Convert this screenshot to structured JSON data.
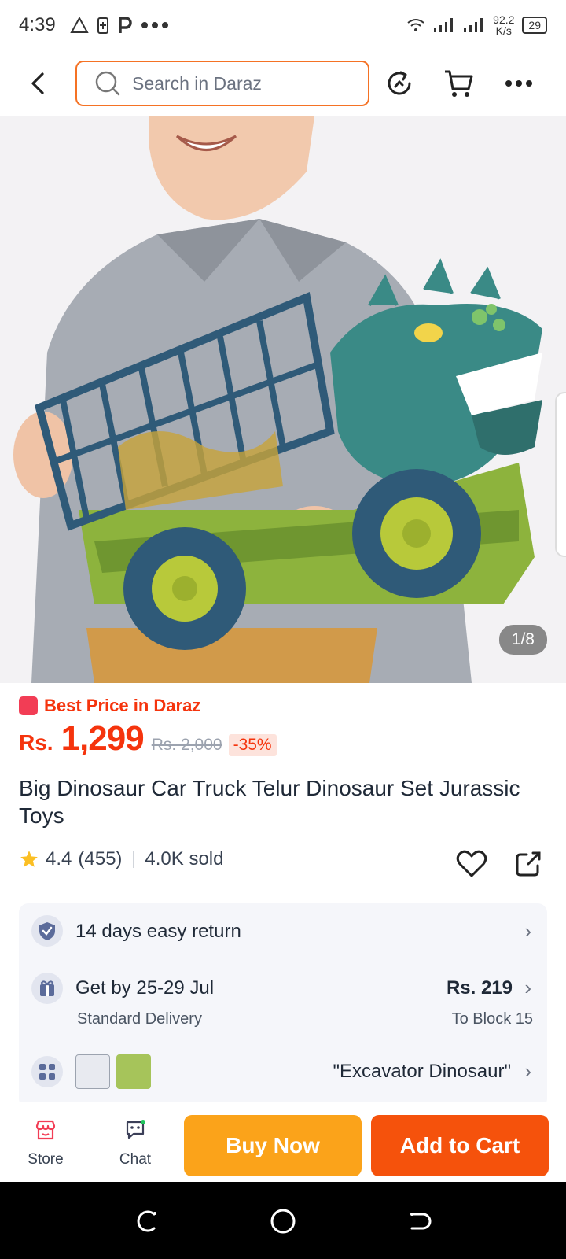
{
  "status_bar": {
    "time": "4:39",
    "speed_value": "92.2",
    "speed_unit": "K/s",
    "battery": "29"
  },
  "search": {
    "placeholder": "Search in Daraz"
  },
  "gallery": {
    "counter": "1/8"
  },
  "product": {
    "badge": "Best Price in Daraz",
    "currency": "Rs.",
    "price": "1,299",
    "original_price": "Rs. 2,000",
    "discount": "-35%",
    "title": "Big Dinosaur Car Truck Telur Dinosaur Set Jurassic Toys",
    "rating": "4.4",
    "reviews": "(455)",
    "sold": "4.0K sold"
  },
  "services": {
    "return": "14 days easy return",
    "delivery_title": "Get by 25-29 Jul",
    "delivery_sub": "Standard Delivery",
    "delivery_price": "Rs. 219",
    "delivery_to": "To Block 15",
    "variant": "\"Excavator Dinosaur\""
  },
  "bottom_bar": {
    "store": "Store",
    "chat": "Chat",
    "buy_now": "Buy Now",
    "add_to_cart": "Add to Cart"
  },
  "colors": {
    "accent": "#f57224",
    "price": "#f5340d",
    "buy_now": "#fba31a",
    "add_to_cart": "#f5520c"
  },
  "icons": [
    "back-arrow-icon",
    "search-icon",
    "refresh-icon",
    "cart-icon",
    "more-icon",
    "star-icon",
    "heart-icon",
    "share-icon",
    "shield-check-icon",
    "gift-icon",
    "variant-grid-icon",
    "store-icon",
    "chat-icon"
  ]
}
